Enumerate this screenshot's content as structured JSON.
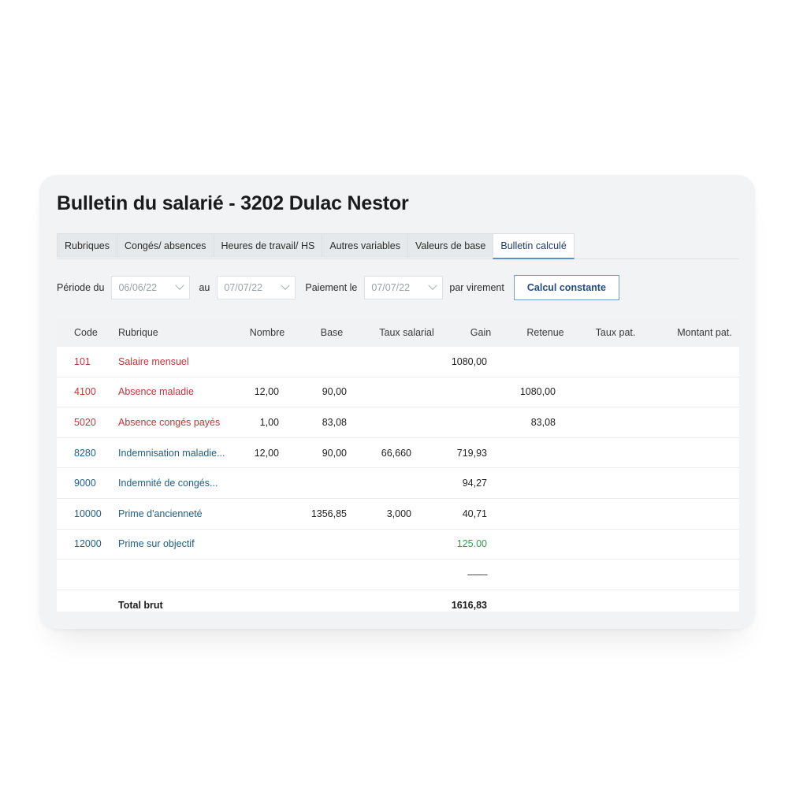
{
  "title": "Bulletin du salarié - 3202 Dulac Nestor",
  "tabs": [
    {
      "label": "Rubriques"
    },
    {
      "label": "Congés/ absences"
    },
    {
      "label": "Heures de travail/ HS"
    },
    {
      "label": "Autres variables"
    },
    {
      "label": "Valeurs de base"
    },
    {
      "label": "Bulletin calculé"
    }
  ],
  "active_tab": "Bulletin calculé",
  "filters": {
    "periode_label": "Période du",
    "periode_start": "06/06/22",
    "au_label": "au",
    "periode_end": "07/07/22",
    "paiement_label": "Paiement le",
    "paiement_date": "07/07/22",
    "virement_label": "par virement",
    "calcul_button": "Calcul constante"
  },
  "table": {
    "headers": {
      "code": "Code",
      "rubrique": "Rubrique",
      "nombre": "Nombre",
      "base": "Base",
      "taux_salarial": "Taux salarial",
      "gain": "Gain",
      "retenue": "Retenue",
      "taux_pat": "Taux pat.",
      "montant_pat": "Montant pat."
    },
    "rows": [
      {
        "code": "101",
        "rubrique": "Salaire mensuel",
        "nombre": "",
        "base": "",
        "taux": "",
        "gain": "1080,00",
        "retenue": ""
      },
      {
        "code": "4100",
        "rubrique": "Absence maladie",
        "nombre": "12,00",
        "base": "90,00",
        "taux": "",
        "gain": "",
        "retenue": "1080,00"
      },
      {
        "code": "5020",
        "rubrique": "Absence congés payés",
        "nombre": "1,00",
        "base": "83,08",
        "taux": "",
        "gain": "",
        "retenue": "83,08"
      },
      {
        "code": "8280",
        "rubrique": "Indemnisation maladie...",
        "nombre": "12,00",
        "base": "90,00",
        "taux": "66,660",
        "gain": "719,93",
        "retenue": ""
      },
      {
        "code": "9000",
        "rubrique": "Indemnité de congés...",
        "nombre": "",
        "base": "",
        "taux": "",
        "gain": "94,27",
        "retenue": ""
      },
      {
        "code": "10000",
        "rubrique": "Prime d'ancienneté",
        "nombre": "",
        "base": "1356,85",
        "taux": "3,000",
        "gain": "40,71",
        "retenue": ""
      },
      {
        "code": "12000",
        "rubrique": "Prime sur objectif",
        "nombre": "",
        "base": "",
        "taux": "",
        "gain": "125.00",
        "retenue": ""
      }
    ],
    "separator": "--------",
    "total_label": "Total brut",
    "total_value": "1616,83"
  },
  "colors": {
    "negative_rows": "#c2353b",
    "positive_rows": "#1f5e86",
    "highlight_gain": "#2e9e4e",
    "button_border": "#6f9ed3"
  }
}
